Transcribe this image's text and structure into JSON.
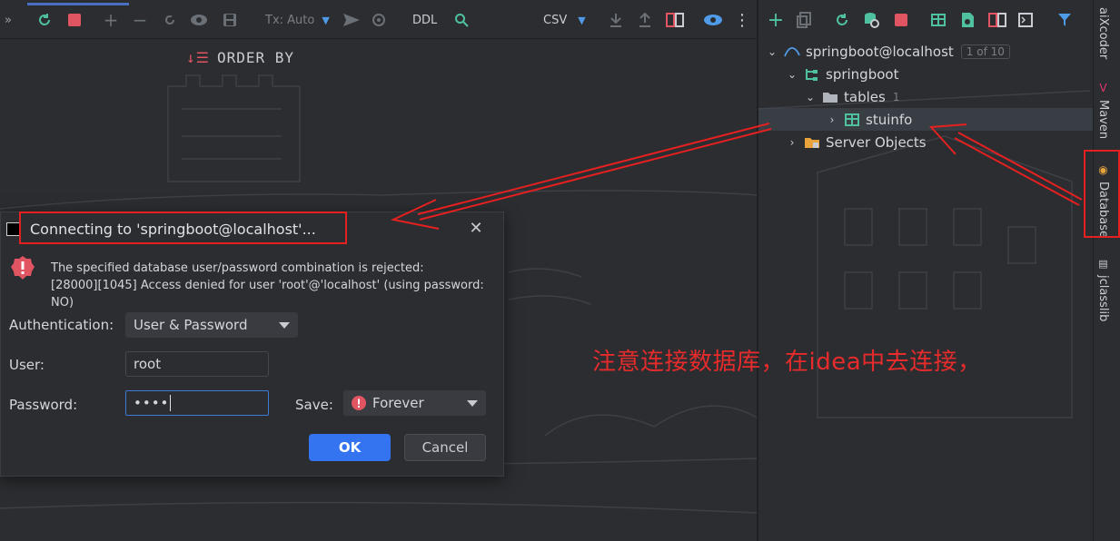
{
  "toolbar": {
    "tx_mode": "Tx: Auto",
    "ddl_label": "DDL",
    "export_format": "CSV"
  },
  "editor": {
    "order_by_label": "ORDER BY"
  },
  "tree": {
    "connection": "springboot@localhost",
    "connection_badge": "1 of 10",
    "schema": "springboot",
    "tables_folder": "tables",
    "tables_count": "1",
    "table_item": "stuinfo",
    "server_objects": "Server Objects"
  },
  "side_tabs": {
    "aixcoder": "aiXcoder",
    "maven": "Maven",
    "database": "Database",
    "jclasslib": "jclasslib"
  },
  "dialog": {
    "title": "Connecting to 'springboot@localhost'...",
    "error_line1": "The specified database user/password combination is rejected:",
    "error_line2": "[28000][1045] Access denied for user 'root'@'localhost' (using password: NO)",
    "auth_label": "Authentication:",
    "auth_value": "User & Password",
    "user_label": "User:",
    "user_value": "root",
    "password_label": "Password:",
    "password_value": "••••",
    "save_label": "Save:",
    "save_value": "Forever",
    "ok_label": "OK",
    "cancel_label": "Cancel"
  },
  "annotation": {
    "note": "注意连接数据库，在idea中去连接，"
  },
  "colors": {
    "accent": "#3574f0",
    "annotation_red": "#e52020",
    "stop_red": "#e05561",
    "refresh_green": "#4fc1a0",
    "panel_bg": "#2b2d30"
  }
}
